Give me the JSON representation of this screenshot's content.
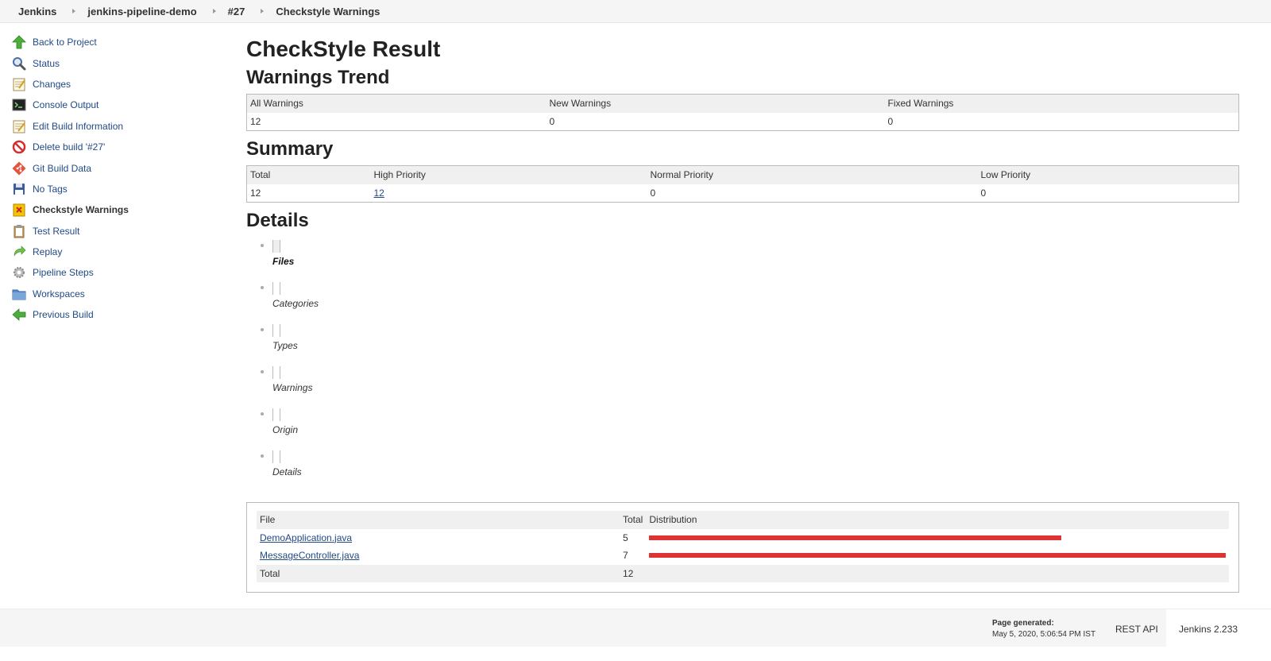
{
  "breadcrumbs": [
    "Jenkins",
    "jenkins-pipeline-demo",
    "#27",
    "Checkstyle Warnings"
  ],
  "sidebar": {
    "items": [
      {
        "label": "Back to Project",
        "icon": "up-arrow-icon"
      },
      {
        "label": "Status",
        "icon": "magnifier-icon"
      },
      {
        "label": "Changes",
        "icon": "notepad-icon"
      },
      {
        "label": "Console Output",
        "icon": "terminal-icon"
      },
      {
        "label": "Edit Build Information",
        "icon": "notepad-edit-icon"
      },
      {
        "label": "Delete build '#27'",
        "icon": "no-entry-icon"
      },
      {
        "label": "Git Build Data",
        "icon": "git-icon"
      },
      {
        "label": "No Tags",
        "icon": "save-icon"
      },
      {
        "label": "Checkstyle Warnings",
        "icon": "checkstyle-icon",
        "active": true
      },
      {
        "label": "Test Result",
        "icon": "clipboard-icon"
      },
      {
        "label": "Replay",
        "icon": "replay-icon"
      },
      {
        "label": "Pipeline Steps",
        "icon": "gear-icon"
      },
      {
        "label": "Workspaces",
        "icon": "folder-icon"
      },
      {
        "label": "Previous Build",
        "icon": "left-arrow-icon"
      }
    ]
  },
  "main": {
    "title": "CheckStyle Result",
    "trend": {
      "heading": "Warnings Trend",
      "headers": [
        "All Warnings",
        "New Warnings",
        "Fixed Warnings"
      ],
      "values": [
        "12",
        "0",
        "0"
      ]
    },
    "summary": {
      "heading": "Summary",
      "headers": [
        "Total",
        "High Priority",
        "Normal Priority",
        "Low Priority"
      ],
      "values": [
        "12",
        "12",
        "0",
        "0"
      ]
    },
    "details": {
      "heading": "Details",
      "tabs": [
        "Files",
        "Categories",
        "Types",
        "Warnings",
        "Origin",
        "Details"
      ],
      "selected_tab": "Files"
    },
    "files_table": {
      "headers": [
        "File",
        "Total",
        "Distribution"
      ],
      "rows": [
        {
          "file": "DemoApplication.java",
          "total": "5",
          "count": 5
        },
        {
          "file": "MessageController.java",
          "total": "7",
          "count": 7
        }
      ],
      "footer_label": "Total",
      "footer_total": "12",
      "bar_color": "#dd3333"
    }
  },
  "footer": {
    "page_generated_label": "Page generated:",
    "page_generated_time": "May 5, 2020, 5:06:54 PM IST",
    "rest_api": "REST API",
    "version": "Jenkins 2.233"
  }
}
